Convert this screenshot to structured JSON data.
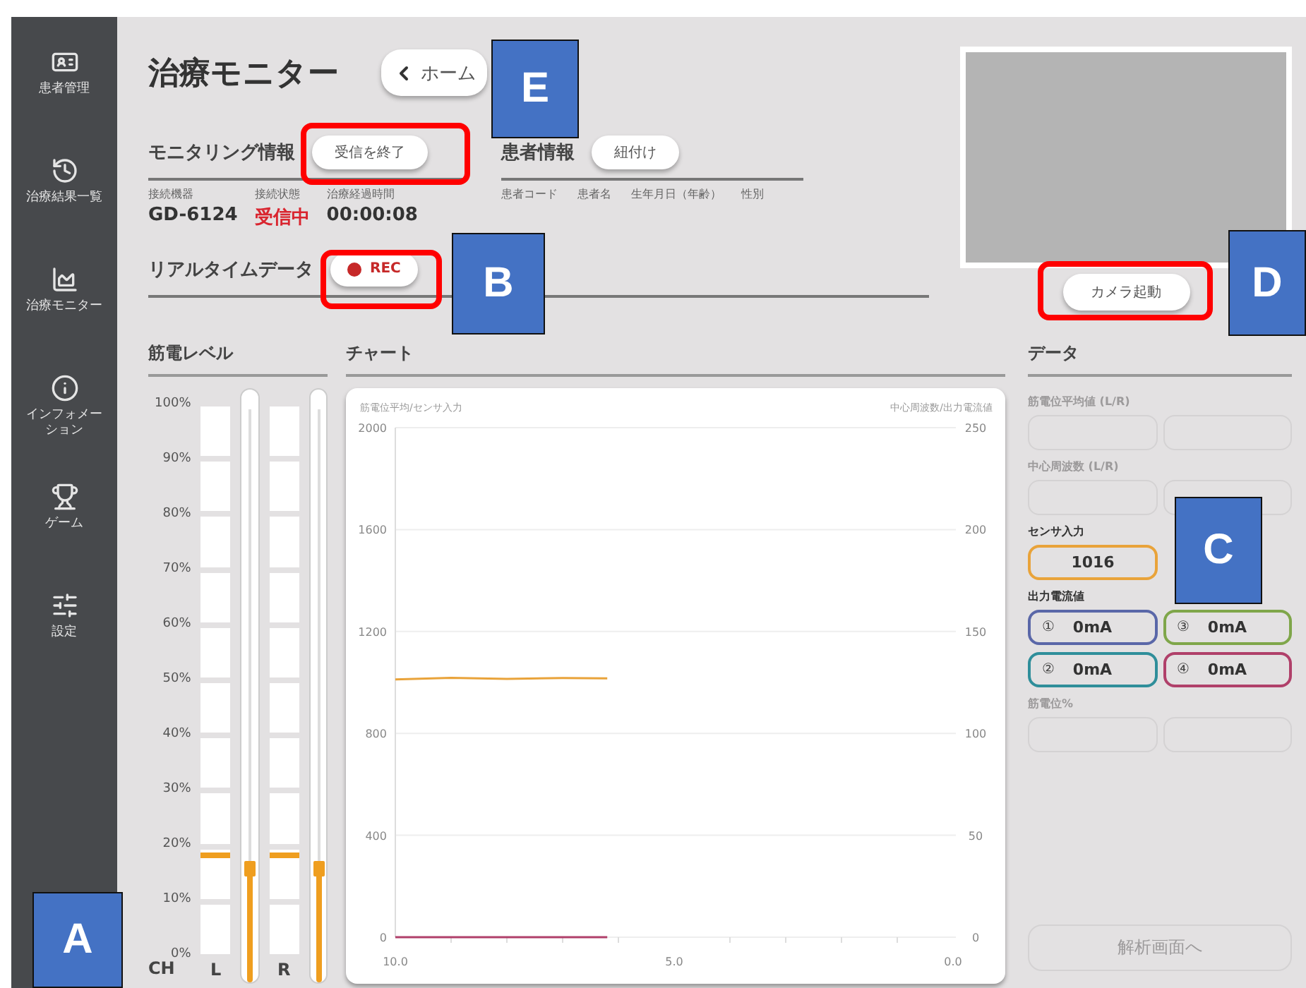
{
  "sidebar": {
    "items": [
      {
        "label": "患者管理"
      },
      {
        "label": "治療結果一覧"
      },
      {
        "label": "治療モニター"
      },
      {
        "label": "インフォメーション"
      },
      {
        "label": "ゲーム"
      },
      {
        "label": "設定"
      }
    ]
  },
  "title": "治療モニター",
  "home_button": {
    "label": "ホーム"
  },
  "monitoring": {
    "heading": "モニタリング情報",
    "stop_button": "受信を終了",
    "fields": [
      {
        "label": "接続機器",
        "value": "GD-6124",
        "kind": "plain"
      },
      {
        "label": "接続状態",
        "value": "受信中",
        "kind": "alert"
      },
      {
        "label": "治療経過時間",
        "value": "00:00:08",
        "kind": "plain"
      }
    ]
  },
  "patient": {
    "heading": "患者情報",
    "link_button": "紐付け",
    "columns": [
      "患者コード",
      "患者名",
      "生年月日（年齢）",
      "性別"
    ]
  },
  "camera": {
    "button": "カメラ起動"
  },
  "realtime": {
    "heading": "リアルタイムデータ",
    "rec_button": {
      "label": "REC",
      "recording": true
    }
  },
  "emg": {
    "heading": "筋電レベル",
    "scale": [
      "100%",
      "90%",
      "80%",
      "70%",
      "60%",
      "50%",
      "40%",
      "30%",
      "20%",
      "10%",
      "0%"
    ],
    "axis_label": "CH",
    "channels": [
      {
        "label": "L",
        "meter": {
          "level": 0.18
        },
        "slider": {
          "level": 0.19
        }
      },
      {
        "label": "R",
        "meter": {
          "level": 0.18
        },
        "slider": {
          "level": 0.19
        }
      }
    ]
  },
  "chart": {
    "heading": "チャート",
    "right_axis": {
      "label": "中心周波数/出力電流値",
      "ticks": [
        "250",
        "200",
        "150",
        "100",
        "50",
        "0"
      ]
    },
    "chart_data": {
      "type": "line",
      "grid": true,
      "ylabel": "筋電位平均/センサ入力",
      "x": [
        10,
        9,
        8,
        7,
        6.2
      ],
      "series": [
        {
          "color": "#e9a33a",
          "values": [
            1012,
            1018,
            1014,
            1017,
            1016
          ]
        },
        {
          "color": "#b0406a",
          "values": [
            0,
            0,
            0,
            0,
            0
          ]
        }
      ],
      "xlim": [
        10,
        0
      ],
      "ylim": [
        0,
        2000
      ],
      "xticks": [
        {
          "value": 10,
          "label": "10.0"
        },
        {
          "value": 5,
          "label": "5.0"
        },
        {
          "value": 0,
          "label": "0.0"
        }
      ],
      "yticks": [
        0,
        400,
        800,
        1200,
        1600,
        2000
      ]
    }
  },
  "data": {
    "heading": "データ",
    "groups": [
      {
        "kind": "pair",
        "label": "筋電位平均値 (L/R)",
        "disabled": true
      },
      {
        "kind": "pair",
        "label": "中心周波数 (L/R)",
        "disabled": true
      },
      {
        "kind": "single",
        "label": "センサ入力",
        "value": "1016",
        "color": "#e9a33a"
      },
      {
        "kind": "outputs",
        "label": "出力電流値",
        "items": [
          {
            "num": "①",
            "value": "0mA",
            "color": "#5a67a8"
          },
          {
            "num": "③",
            "value": "0mA",
            "color": "#7fa64a"
          },
          {
            "num": "②",
            "value": "0mA",
            "color": "#2f8e9a"
          },
          {
            "num": "④",
            "value": "0mA",
            "color": "#b0406a"
          }
        ]
      },
      {
        "kind": "pair",
        "label": "筋電位%",
        "disabled": true
      }
    ],
    "analyze_button": {
      "label": "解析画面へ",
      "disabled": true
    }
  },
  "annotations": [
    {
      "letter": "E",
      "framed": true
    },
    {
      "letter": "B",
      "framed": true
    },
    {
      "letter": "D",
      "framed": true
    },
    {
      "letter": "C",
      "framed": false
    },
    {
      "letter": "A",
      "framed": false
    }
  ]
}
